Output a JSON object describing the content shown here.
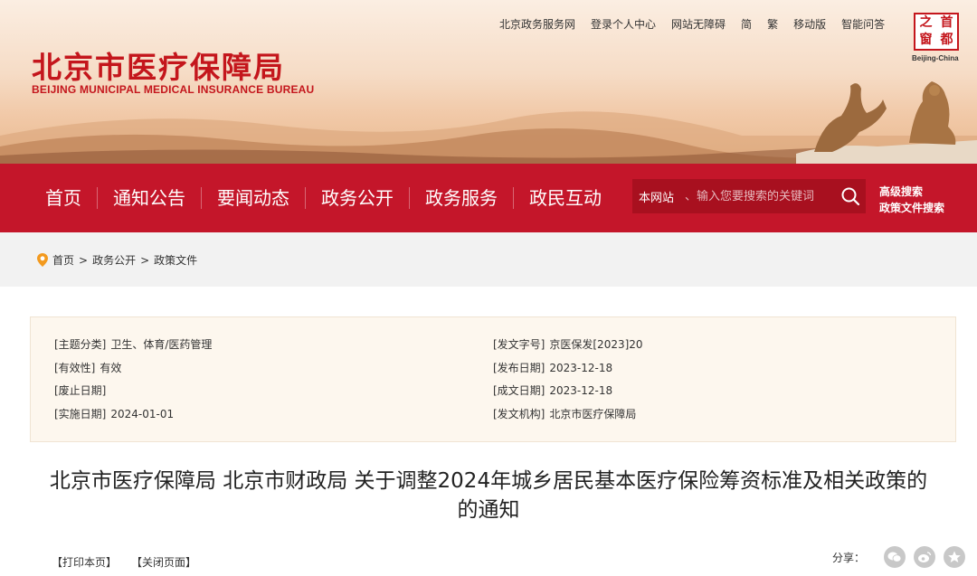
{
  "header": {
    "brand_cn": "北京市医疗保障局",
    "brand_en": "BEIJING MUNICIPAL MEDICAL INSURANCE BUREAU",
    "top_links": [
      "北京政务服务网",
      "登录个人中心",
      "网站无障碍",
      "简",
      "繁",
      "移动版",
      "智能问答"
    ],
    "seal_chars": [
      "之",
      "首",
      "窗",
      "都"
    ],
    "seal_caption": "Beijing-China"
  },
  "nav": {
    "items": [
      "首页",
      "通知公告",
      "要闻动态",
      "政务公开",
      "政务服务",
      "政民互动"
    ],
    "search_scope": "本网站",
    "search_placeholder": "、输入您要搜索的关键词",
    "advanced_search": "高级搜索",
    "policy_search": "政策文件搜索"
  },
  "breadcrumb": [
    "首页",
    "政务公开",
    "政策文件"
  ],
  "meta": {
    "left": [
      {
        "key": "[主题分类]",
        "value": "卫生、体育/医药管理"
      },
      {
        "key": "[有效性]",
        "value": "有效"
      },
      {
        "key": "[废止日期]",
        "value": ""
      },
      {
        "key": "[实施日期]",
        "value": "2024-01-01"
      }
    ],
    "right": [
      {
        "key": "[发文字号]",
        "value": "京医保发[2023]20"
      },
      {
        "key": "[发布日期]",
        "value": "2023-12-18"
      },
      {
        "key": "[成文日期]",
        "value": "2023-12-18"
      },
      {
        "key": "[发文机构]",
        "value": "北京市医疗保障局"
      }
    ]
  },
  "article": {
    "title_line1": "北京市医疗保障局 北京市财政局 关于调整2024年城乡居民基本医疗保险筹资标准及相关政策的",
    "title_line2": "的通知"
  },
  "tools": {
    "print": "【打印本页】",
    "close": "【关闭页面】",
    "share_label": "分享："
  },
  "colors": {
    "brand_red": "#c4161c",
    "nav_red": "#c4162a",
    "search_bg": "#a8101f",
    "meta_bg": "#fdf7ee"
  }
}
